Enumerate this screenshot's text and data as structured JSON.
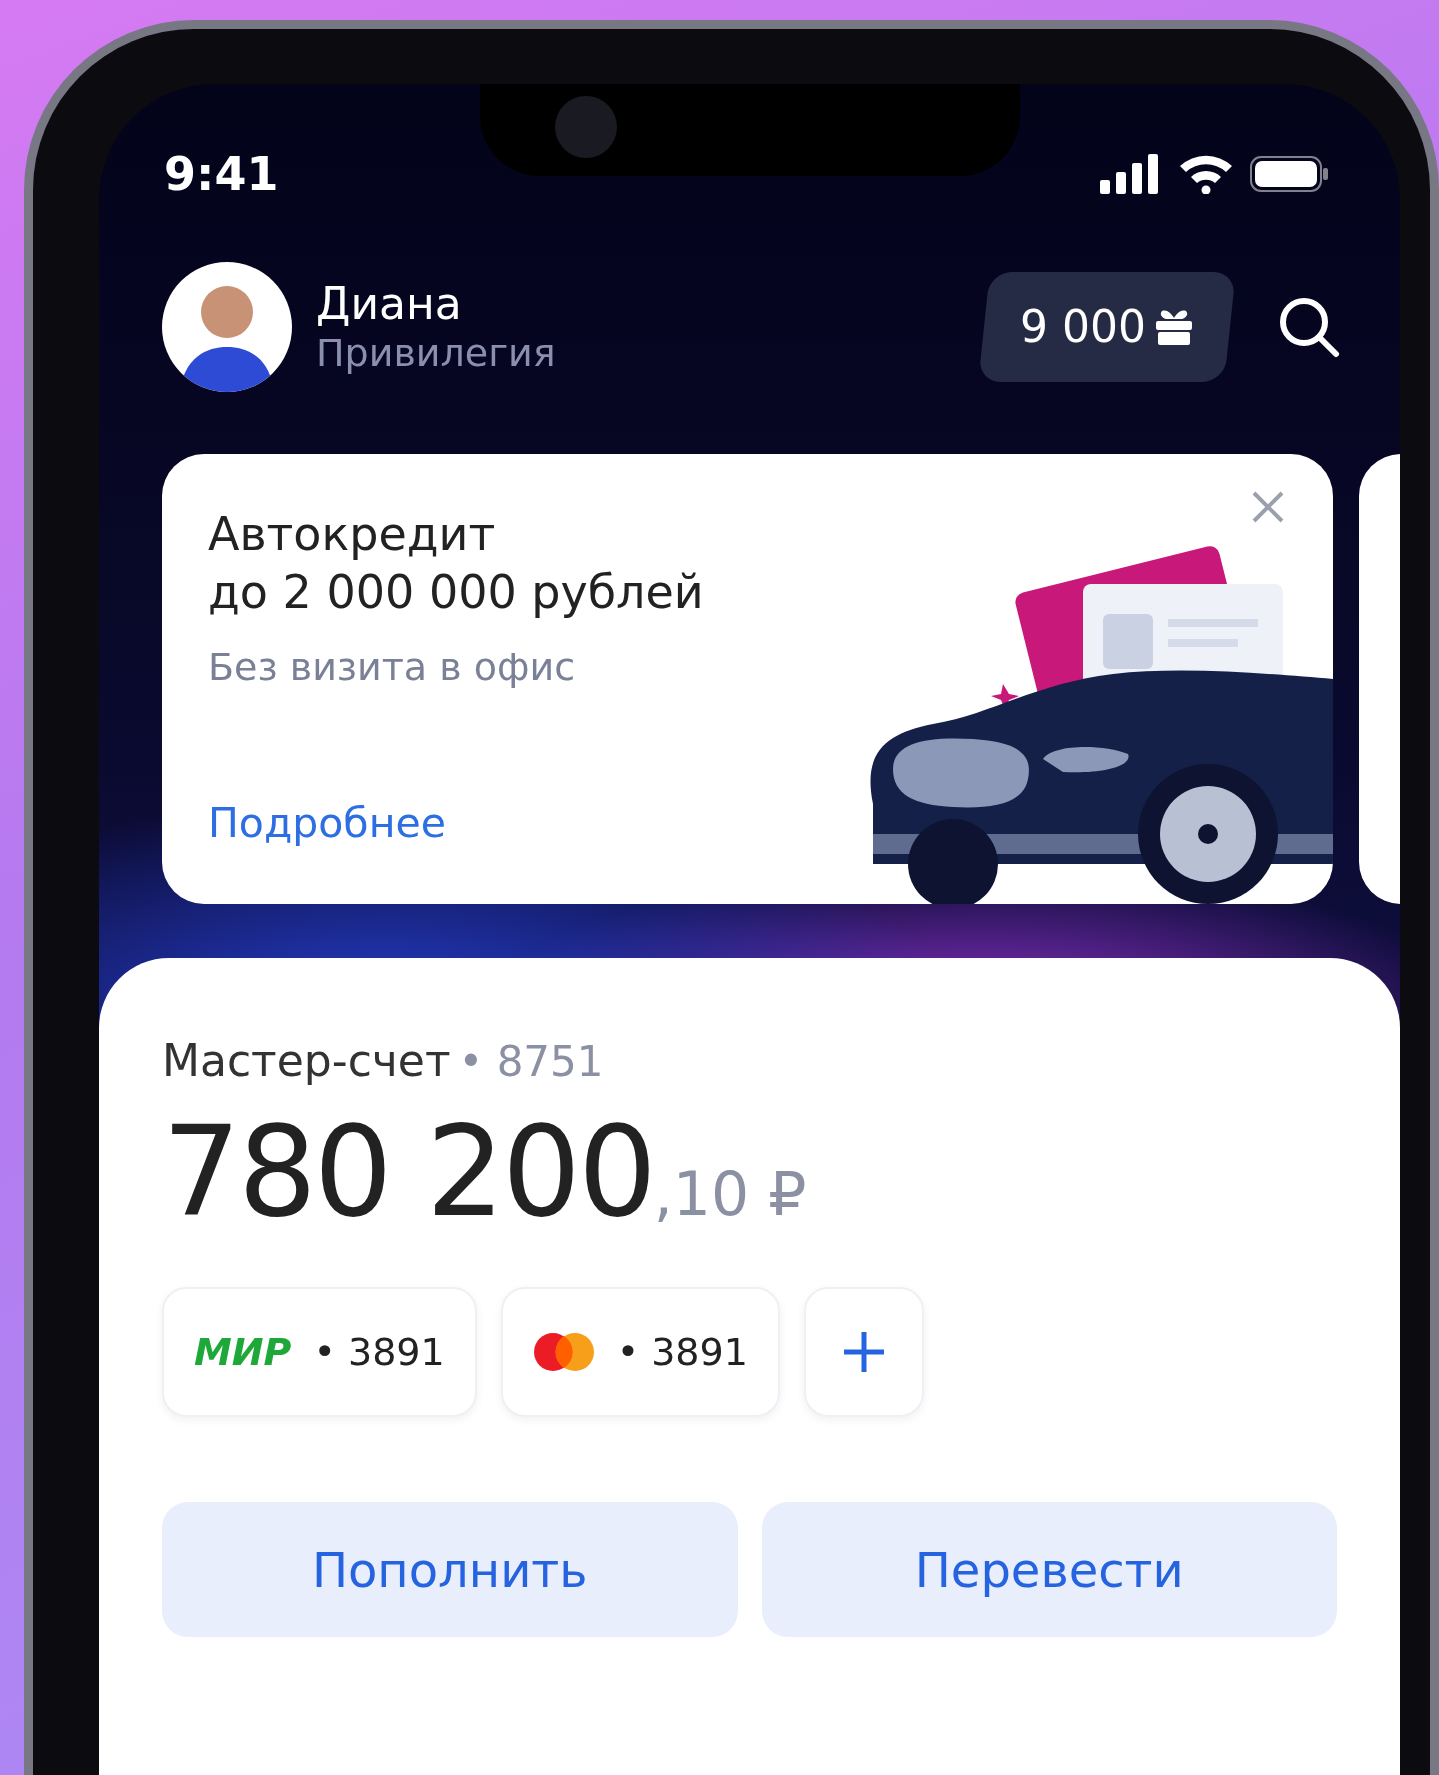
{
  "status_bar": {
    "time": "9:41"
  },
  "profile": {
    "name": "Диана",
    "tier": "Привилегия"
  },
  "bonus": {
    "amount": "9 000"
  },
  "promo": {
    "title": "Автокредит",
    "subtitle": "до 2 000 000 рублей",
    "note": "Без визита в офис",
    "link": "Подробнее"
  },
  "account": {
    "name": "Мастер-счет",
    "number": "• 8751",
    "balance_main": "780 200",
    "balance_fraction": ",10 ₽"
  },
  "cards": [
    {
      "kind": "mir",
      "logo": "МИР",
      "number": "• 3891"
    },
    {
      "kind": "mastercard",
      "number": "• 3891"
    }
  ],
  "actions": [
    "Пополнить",
    "Перевести"
  ]
}
